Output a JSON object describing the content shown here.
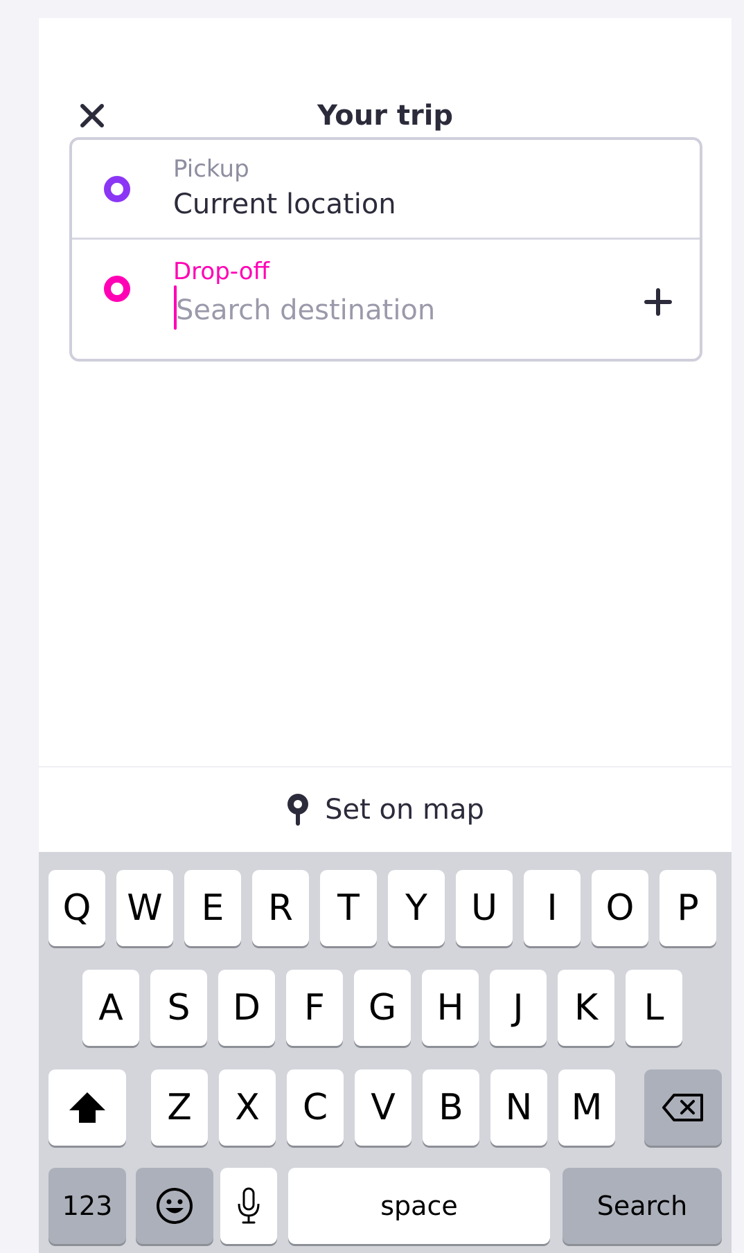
{
  "header": {
    "title": "Your trip",
    "close_icon": "close-icon"
  },
  "trip": {
    "pickup": {
      "label": "Pickup",
      "value": "Current location",
      "dot_color": "#8b36f5"
    },
    "dropoff": {
      "label": "Drop-off",
      "placeholder": "Search destination",
      "value": "",
      "dot_color": "#ff00b4",
      "add_icon": "plus-icon"
    }
  },
  "set_on_map": {
    "label": "Set on map",
    "icon": "map-pin-icon"
  },
  "keyboard": {
    "row1": [
      "Q",
      "W",
      "E",
      "R",
      "T",
      "Y",
      "U",
      "I",
      "O",
      "P"
    ],
    "row2": [
      "A",
      "S",
      "D",
      "F",
      "G",
      "H",
      "J",
      "K",
      "L"
    ],
    "row3": [
      "Z",
      "X",
      "C",
      "V",
      "B",
      "N",
      "M"
    ],
    "numbers_label": "123",
    "space_label": "space",
    "search_label": "Search",
    "shift_icon": "shift-icon",
    "delete_icon": "backspace-icon",
    "emoji_icon": "emoji-icon",
    "mic_icon": "microphone-icon"
  },
  "colors": {
    "accent_purple": "#8b36f5",
    "accent_pink": "#ff00b4",
    "text_dark": "#2b2b3b"
  }
}
